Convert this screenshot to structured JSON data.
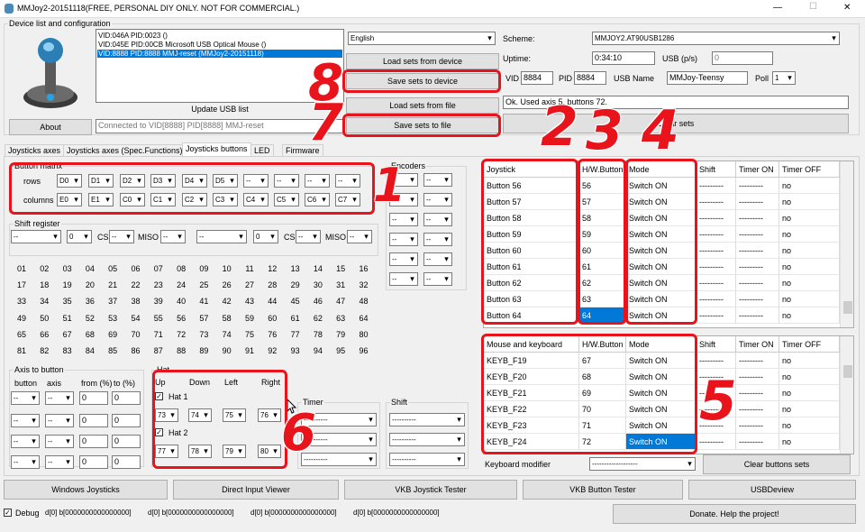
{
  "window": {
    "title": "MMJoy2-20151118(FREE, PERSONAL DIY ONLY. NOT FOR COMMERCIAL.)",
    "minimize": "—",
    "maximize": "☐",
    "close": "✕"
  },
  "device_group": {
    "label": "Device list and configuration"
  },
  "device_list": [
    "VID:046A PID:0023 ()",
    "VID:045E PID:00CB Microsoft USB Optical Mouse ()",
    "VID:8888 PID:8888 MMJ-reset (MMJoy2-20151118)"
  ],
  "language": "English",
  "buttons": {
    "load_from_device": "Load sets from device",
    "save_to_device": "Save sets to device",
    "load_from_file": "Load sets from file",
    "save_to_file": "Save sets to file",
    "update_usb": "Update USB list",
    "about": "About",
    "clear_sets": "Clear sets",
    "clear_buttons": "Clear buttons sets",
    "windows_joysticks": "Windows Joysticks",
    "direct_input": "Direct Input Viewer",
    "vkb_joystick": "VKB Joystick Tester",
    "vkb_button": "VKB Button Tester",
    "usbdeview": "USBDeview",
    "donate": "Donate. Help the project!"
  },
  "connected": "Connected to VID[8888] PID[8888] MMJ-reset",
  "scheme": {
    "label": "Scheme:",
    "value": "MMJOY2.AT90USB1286"
  },
  "uptime": {
    "label": "Uptime:",
    "value": "0:34:10",
    "usb_label": "USB (p/s)",
    "usb_value": "0"
  },
  "vid": {
    "label": "VID",
    "value": "8884",
    "pid_label": "PID",
    "pid_value": "8884",
    "usbname_label": "USB Name",
    "usbname_value": "MMJoy-Teensy",
    "poll_label": "Poll",
    "poll_value": "1"
  },
  "status": "Ok. Used axis  5, buttons 72.",
  "tabs": [
    "Joysticks axes",
    "Joysticks axes (Spec.Functions)",
    "Joysticks buttons",
    "LED",
    "Firmware"
  ],
  "matrix": {
    "label": "Button matrix",
    "rows_label": "rows",
    "cols_label": "columns",
    "rows": [
      "D0",
      "D1",
      "D2",
      "D3",
      "D4",
      "D5",
      "--",
      "--",
      "--",
      "--"
    ],
    "cols": [
      "E0",
      "E1",
      "C0",
      "C1",
      "C2",
      "C3",
      "C4",
      "C5",
      "C6",
      "C7"
    ]
  },
  "encoders": {
    "label": "Encoders",
    "value": "--"
  },
  "shift_reg": {
    "label": "Shift register",
    "v1": "--",
    "v2": "0",
    "cs": "CS",
    "miso": "MISO",
    "v3": "--",
    "v4": "--",
    "v5": "--",
    "v6": "0",
    "v7": "--",
    "v8": "--"
  },
  "numbers": [
    "01",
    "02",
    "03",
    "04",
    "05",
    "06",
    "07",
    "08",
    "09",
    "10",
    "11",
    "12",
    "13",
    "14",
    "15",
    "16",
    "17",
    "18",
    "19",
    "20",
    "21",
    "22",
    "23",
    "24",
    "25",
    "26",
    "27",
    "28",
    "29",
    "30",
    "31",
    "32",
    "33",
    "34",
    "35",
    "36",
    "37",
    "38",
    "39",
    "40",
    "41",
    "42",
    "43",
    "44",
    "45",
    "46",
    "47",
    "48",
    "49",
    "50",
    "51",
    "52",
    "53",
    "54",
    "55",
    "56",
    "57",
    "58",
    "59",
    "60",
    "61",
    "62",
    "63",
    "64",
    "65",
    "66",
    "67",
    "68",
    "69",
    "70",
    "71",
    "72",
    "73",
    "74",
    "75",
    "76",
    "77",
    "78",
    "79",
    "80",
    "81",
    "82",
    "83",
    "84",
    "85",
    "86",
    "87",
    "88",
    "89",
    "90",
    "91",
    "92",
    "93",
    "94",
    "95",
    "96"
  ],
  "axis_to_button": {
    "label": "Axis to button",
    "h_button": "button",
    "h_axis": "axis",
    "h_from": "from (%)",
    "h_to": "to (%)",
    "dd": "--",
    "val": "0"
  },
  "hat": {
    "label": "Hat",
    "up": "Up",
    "down": "Down",
    "left": "Left",
    "right": "Right",
    "hat1": "Hat 1",
    "hat2": "Hat 2",
    "h1": [
      "73",
      "74",
      "75",
      "76"
    ],
    "h2": [
      "77",
      "78",
      "79",
      "80"
    ]
  },
  "timer": {
    "label": "Timer",
    "value": "----------"
  },
  "shift": {
    "label": "Shift",
    "value": "----------"
  },
  "joy_table": {
    "headers": [
      "Joystick",
      "H/W.Button",
      "Mode",
      "Shift",
      "Timer ON",
      "Timer OFF"
    ],
    "rows": [
      [
        "Button 56",
        "56",
        "Switch ON",
        "---------",
        "---------",
        "no"
      ],
      [
        "Button 57",
        "57",
        "Switch ON",
        "---------",
        "---------",
        "no"
      ],
      [
        "Button 58",
        "58",
        "Switch ON",
        "---------",
        "---------",
        "no"
      ],
      [
        "Button 59",
        "59",
        "Switch ON",
        "---------",
        "---------",
        "no"
      ],
      [
        "Button 60",
        "60",
        "Switch ON",
        "---------",
        "---------",
        "no"
      ],
      [
        "Button 61",
        "61",
        "Switch ON",
        "---------",
        "---------",
        "no"
      ],
      [
        "Button 62",
        "62",
        "Switch ON",
        "---------",
        "---------",
        "no"
      ],
      [
        "Button 63",
        "63",
        "Switch ON",
        "---------",
        "---------",
        "no"
      ],
      [
        "Button 64",
        "64",
        "Switch ON",
        "---------",
        "---------",
        "no"
      ]
    ]
  },
  "kb_table": {
    "headers": [
      "Mouse and keyboard",
      "H/W.Button",
      "Mode",
      "Shift",
      "Timer ON",
      "Timer OFF"
    ],
    "rows": [
      [
        "KEYB_F19",
        "67",
        "Switch ON",
        "---------",
        "---------",
        "no"
      ],
      [
        "KEYB_F20",
        "68",
        "Switch ON",
        "---------",
        "---------",
        "no"
      ],
      [
        "KEYB_F21",
        "69",
        "Switch ON",
        "---------",
        "---------",
        "no"
      ],
      [
        "KEYB_F22",
        "70",
        "Switch ON",
        "---------",
        "---------",
        "no"
      ],
      [
        "KEYB_F23",
        "71",
        "Switch ON",
        "---------",
        "---------",
        "no"
      ],
      [
        "KEYB_F24",
        "72",
        "Switch ON",
        "---------",
        "---------",
        "no"
      ]
    ]
  },
  "kb_modifier": {
    "label": "Keyboard modifier",
    "value": "-------------------"
  },
  "debug": {
    "label": "Debug",
    "values": [
      "d[0] b[0000000000000000]",
      "d[0] b[0000000000000000]",
      "d[0] b[0000000000000000]",
      "d[0] b[0000000000000000]"
    ]
  },
  "annotations": [
    "1",
    "2",
    "3",
    "4",
    "5",
    "6",
    "7",
    "8"
  ],
  "colors": {
    "annotation": "#e8131b",
    "selection": "#0078d7"
  }
}
